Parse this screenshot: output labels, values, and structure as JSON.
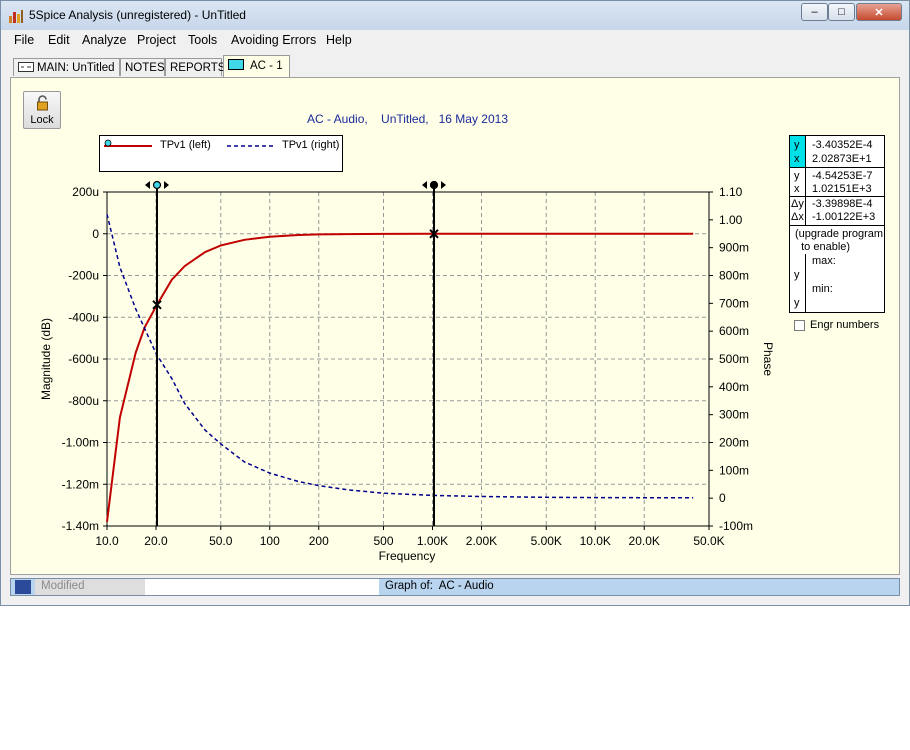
{
  "window": {
    "title": "5Spice Analysis (unregistered) - UnTitled",
    "buttons": {
      "minimize": "–",
      "maximize": "□",
      "close": "✕"
    }
  },
  "menu": [
    {
      "label": "File"
    },
    {
      "label": "Edit"
    },
    {
      "label": "Analyze"
    },
    {
      "label": "Project"
    },
    {
      "label": "Tools"
    },
    {
      "label": "Avoiding Errors"
    },
    {
      "label": "Help"
    }
  ],
  "tabs": [
    {
      "label": "MAIN:  UnTitled"
    },
    {
      "label": "NOTES"
    },
    {
      "label": "REPORTS"
    },
    {
      "label": "AC - 1",
      "active": true
    }
  ],
  "toolbar": {
    "lock_label": "Lock"
  },
  "plot": {
    "title": "AC - Audio,    UnTitled,   16 May 2013",
    "legend": [
      {
        "label": "TPv1 (left)",
        "color": "#c00000",
        "style": "solid"
      },
      {
        "label": "TPv1 (right)",
        "color": "#00008b",
        "style": "dashed"
      }
    ]
  },
  "chart_data": {
    "type": "line",
    "xlabel": "Frequency",
    "ylabel": "Magnitude (dB)",
    "y2label": "Phase",
    "xscale": "log",
    "xlim": [
      10,
      50000
    ],
    "ylim": [
      -0.0014,
      0.0002
    ],
    "y2lim": [
      -0.1,
      1.1
    ],
    "grid": true,
    "xticks": [
      "10.0",
      "20.0",
      "50.0",
      "100",
      "200",
      "500",
      "1.00K",
      "2.00K",
      "5.00K",
      "10.0K",
      "20.0K",
      "50.0K"
    ],
    "xtick_values": [
      10,
      20,
      50,
      100,
      200,
      500,
      1000,
      2000,
      5000,
      10000,
      20000,
      50000
    ],
    "yticks": [
      "200u",
      "0",
      "-200u",
      "-400u",
      "-600u",
      "-800u",
      "-1.00m",
      "-1.20m",
      "-1.40m"
    ],
    "ytick_values": [
      0.0002,
      0,
      -0.0002,
      -0.0004,
      -0.0006,
      -0.0008,
      -0.001,
      -0.0012,
      -0.0014
    ],
    "y2ticks": [
      "1.10",
      "1.00",
      "900m",
      "800m",
      "700m",
      "600m",
      "500m",
      "400m",
      "300m",
      "200m",
      "100m",
      "0",
      "-100m"
    ],
    "y2tick_values": [
      1.1,
      1.0,
      0.9,
      0.8,
      0.7,
      0.6,
      0.5,
      0.4,
      0.3,
      0.2,
      0.1,
      0,
      -0.1
    ],
    "series": [
      {
        "name": "TPv1 (left)",
        "axis": "left",
        "color": "#c00000",
        "x": [
          10,
          12,
          15,
          17,
          20.3,
          25,
          30,
          40,
          50,
          70,
          100,
          150,
          200,
          300,
          500,
          1000,
          2000,
          5000,
          10000,
          20000,
          40000
        ],
        "y": [
          -0.00138,
          -0.00088,
          -0.00057,
          -0.00045,
          -0.00034,
          -0.00022,
          -0.000155,
          -8.8e-05,
          -5.6e-05,
          -2.9e-05,
          -1.4e-05,
          -6e-06,
          -3e-06,
          -1.5e-06,
          -6e-07,
          -4.5e-07,
          -2e-07,
          -1e-07,
          0,
          0,
          0
        ]
      },
      {
        "name": "TPv1 (right)",
        "axis": "right",
        "color": "#00008b",
        "x": [
          10,
          12,
          15,
          20,
          25,
          30,
          40,
          50,
          70,
          100,
          150,
          200,
          300,
          500,
          1000,
          2000,
          5000,
          10000,
          20000,
          40000
        ],
        "y": [
          1.02,
          0.83,
          0.68,
          0.52,
          0.43,
          0.34,
          0.245,
          0.195,
          0.13,
          0.09,
          0.06,
          0.045,
          0.03,
          0.018,
          0.01,
          0.006,
          0.003,
          0.002,
          0.0015,
          0.0015
        ]
      }
    ],
    "cursors": [
      {
        "x": 20.2873,
        "y": -0.000340352
      },
      {
        "x": 1021.51,
        "y": -4.54253e-07
      }
    ]
  },
  "readout": {
    "c1": {
      "ylabel": "y",
      "xlabel": "x",
      "y": "-3.40352E-4",
      "x": "2.02873E+1"
    },
    "c2": {
      "ylabel": "y",
      "xlabel": "x",
      "y": "-4.54253E-7",
      "x": "1.02151E+3"
    },
    "delta": {
      "ylabel": "Δy",
      "xlabel": "Δx",
      "y": "-3.39898E-4",
      "x": "-1.00122E+3"
    },
    "upgrade_note": "(upgrade program\n  to enable)",
    "max_label": "max:",
    "min_label": "min:",
    "y_label": "y",
    "c1_highlight": "#00e0e8"
  },
  "engr": {
    "label": "Engr numbers",
    "checked": false
  },
  "status": {
    "modified": "Modified",
    "graph_of": "Graph of:  AC - Audio"
  }
}
